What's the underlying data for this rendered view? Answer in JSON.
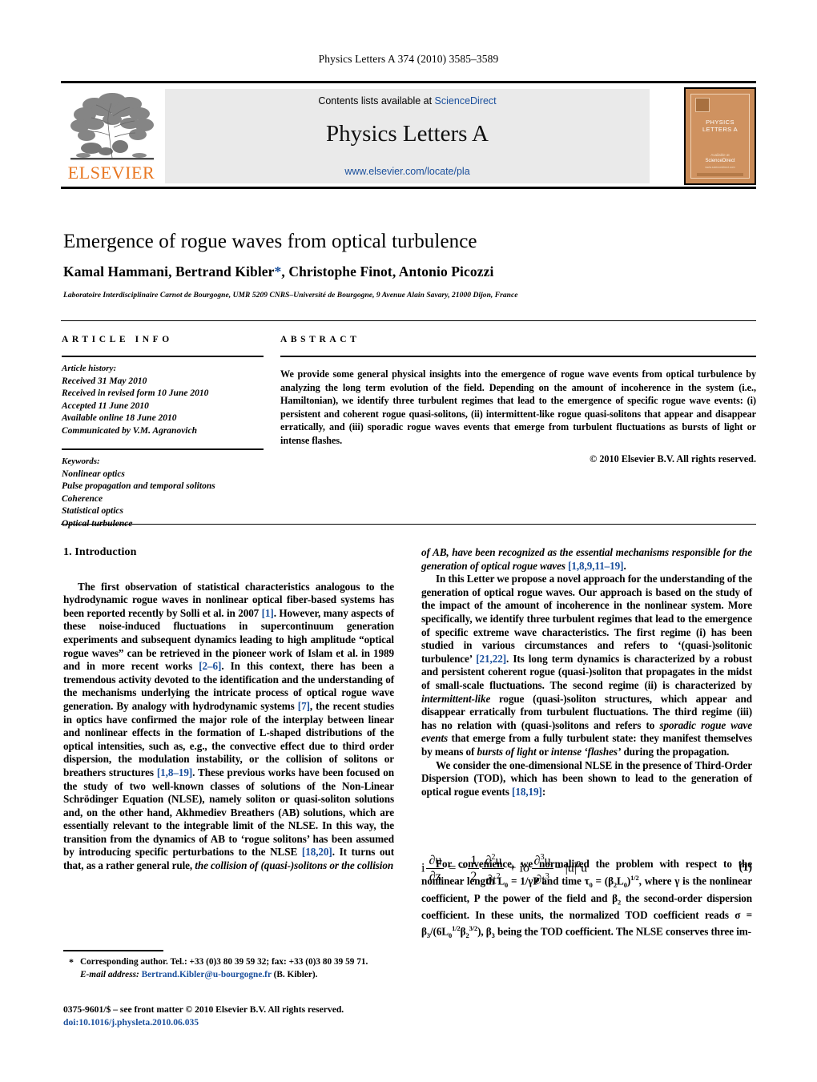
{
  "running_head": "Physics Letters A 374 (2010) 3585–3589",
  "masthead": {
    "contents_line_prefix": "Contents lists available at ",
    "sciencedirect_link": "ScienceDirect",
    "journal_title": "Physics Letters A",
    "journal_url": "www.elsevier.com/locate/pla",
    "publisher_name": "ELSEVIER",
    "cover": {
      "name": "PHYSICS LETTERS A",
      "foot1": "Available at",
      "foot2": "ScienceDirect",
      "foot3": "www.sciencedirect.com",
      "bottom_note": "www.elsevier.com/locate/pla"
    }
  },
  "article": {
    "title": "Emergence of rogue waves from optical turbulence",
    "authors": "Kamal Hammani, Bertrand Kibler",
    "authors_star": "*",
    "authors_rest": ", Christophe Finot, Antonio Picozzi",
    "affiliation": "Laboratoire Interdisciplinaire Carnot de Bourgogne, UMR 5209 CNRS–Université de Bourgogne, 9 Avenue Alain Savary, 21000 Dijon, France"
  },
  "article_info": {
    "heading": "ARTICLE INFO",
    "history_label": "Article history:",
    "history": [
      "Received 31 May 2010",
      "Received in revised form 10 June 2010",
      "Accepted 11 June 2010",
      "Available online 18 June 2010",
      "Communicated by V.M. Agranovich"
    ],
    "keywords_label": "Keywords:",
    "keywords": [
      "Nonlinear optics",
      "Pulse propagation and temporal solitons",
      "Coherence",
      "Statistical optics",
      "Optical turbulence"
    ]
  },
  "abstract": {
    "heading": "ABSTRACT",
    "text": "We provide some general physical insights into the emergence of rogue wave events from optical turbulence by analyzing the long term evolution of the field. Depending on the amount of incoherence in the system (i.e., Hamiltonian), we identify three turbulent regimes that lead to the emergence of specific rogue wave events: (i) persistent and coherent rogue quasi-solitons, (ii) intermittent-like rogue quasi-solitons that appear and disappear erratically, and (iii) sporadic rogue waves events that emerge from turbulent fluctuations as bursts of light or intense flashes.",
    "copyright": "© 2010 Elsevier B.V. All rights reserved."
  },
  "body": {
    "section_heading": "1. Introduction",
    "left_paragraphs": [
      {
        "parts": [
          {
            "t": "The first observation of statistical characteristics analogous to the hydrodynamic rogue waves in nonlinear optical fiber-based systems has been reported recently by Solli et al. in 2007 ",
            "s": "n"
          },
          {
            "t": "[1]",
            "s": "ref"
          },
          {
            "t": ". However, many aspects of these noise-induced fluctuations in supercontinuum generation experiments and subsequent dynamics leading to high amplitude “optical rogue waves” can be retrieved in the pioneer work of Islam et al. in 1989 and in more recent works ",
            "s": "n"
          },
          {
            "t": "[2–6]",
            "s": "ref"
          },
          {
            "t": ". In this context, there has been a tremendous activity devoted to the identification and the understanding of the mechanisms underlying the intricate process of optical rogue wave generation. By analogy with hydrodynamic systems ",
            "s": "n"
          },
          {
            "t": "[7]",
            "s": "ref"
          },
          {
            "t": ", the recent studies in optics have confirmed the major role of the interplay between linear and nonlinear effects in the formation of L-shaped distributions of the optical intensities, such as, e.g., the convective effect due to third order dispersion, the modulation instability, or the collision of solitons or breathers structures ",
            "s": "n"
          },
          {
            "t": "[1,8–19]",
            "s": "ref"
          },
          {
            "t": ". These previous works have been focused on the study of two well-known classes of solutions of the Non-Linear Schrödinger Equation (NLSE), namely soliton or quasi-soliton solutions and, on the other hand, Akhmediev Breathers (AB) solutions, which are essentially relevant to the integrable limit of the NLSE. In this way, the transition from the dynamics of AB to ‘rogue solitons’ has been assumed by introducing specific perturbations to the NLSE ",
            "s": "n"
          },
          {
            "t": "[18,20]",
            "s": "ref"
          },
          {
            "t": ". It turns out that, as a rather general rule, ",
            "s": "n"
          },
          {
            "t": "the collision of (quasi-)solitons or the collision",
            "s": "i"
          }
        ],
        "indent": true
      }
    ],
    "right_paragraphs": [
      {
        "parts": [
          {
            "t": "of AB, have been recognized as the essential mechanisms responsible for the generation of optical rogue waves",
            "s": "i"
          },
          {
            "t": " ",
            "s": "n"
          },
          {
            "t": "[1,8,9,11–19]",
            "s": "ref"
          },
          {
            "t": ".",
            "s": "n"
          }
        ],
        "indent": false
      },
      {
        "parts": [
          {
            "t": "In this Letter we propose a novel approach for the understanding of the generation of optical rogue waves. Our approach is based on the study of the impact of the amount of incoherence in the nonlinear system. More specifically, we identify three turbulent regimes that lead to the emergence of specific extreme wave characteristics. The first regime (i) has been studied in various circumstances and refers to ‘(quasi-)solitonic turbulence’ ",
            "s": "n"
          },
          {
            "t": "[21,22]",
            "s": "ref"
          },
          {
            "t": ". Its long term dynamics is characterized by a robust and persistent coherent rogue (quasi-)soliton that propagates in the midst of small-scale fluctuations. The second regime (ii) is characterized by ",
            "s": "n"
          },
          {
            "t": "intermittent-like",
            "s": "i"
          },
          {
            "t": " rogue (quasi-)soliton structures, which appear and disappear erratically from turbulent fluctuations. The third regime (iii) has no relation with (quasi-)solitons and refers to ",
            "s": "n"
          },
          {
            "t": "sporadic rogue wave events",
            "s": "i"
          },
          {
            "t": " that emerge from a fully turbulent state: they manifest themselves by means of ",
            "s": "n"
          },
          {
            "t": "bursts of light",
            "s": "i"
          },
          {
            "t": " or ",
            "s": "n"
          },
          {
            "t": "intense ‘flashes’",
            "s": "i"
          },
          {
            "t": " during the propagation.",
            "s": "n"
          }
        ],
        "indent": true
      },
      {
        "parts": [
          {
            "t": "We consider the one-dimensional NLSE in the presence of Third-Order Dispersion (TOD), which has been shown to lead to the generation of optical rogue events ",
            "s": "n"
          },
          {
            "t": "[18,19]",
            "s": "ref"
          },
          {
            "t": ":",
            "s": "n"
          }
        ],
        "indent": true
      }
    ],
    "after_equation": {
      "line1": "For convenience, we normalized the problem with respect to",
      "line2_a": "the nonlinear length L",
      "line2_b": " = 1/γP and time τ",
      "line2_c": " = (β",
      "line2_d": "L",
      "line2_e": ")",
      "line2_f": ", where",
      "line3": "γ is the nonlinear coefficient, P the average power of the",
      "line4_a": "field and β",
      "line4_b": " the second-order dispersion coefficient. In these",
      "line5_a": "units, the normalized TOD coefficient reads σ = β",
      "line5_b": "/(6L",
      "line5_c": "β",
      "line5_d": "),",
      "line6_a": "β",
      "line6_b": " being the TOD coefficient. The NLSE conserves three im-"
    }
  },
  "equation": {
    "number": "(1)",
    "lhs_i": "i",
    "lhs_num": "∂u",
    "lhs_den": "∂z",
    "eq": "= −",
    "f1_num": "1",
    "f1_den": "2",
    "f2_num": "∂",
    "f2_num_sup": "2",
    "f2_num_var": "u",
    "f2_den": "∂t",
    "f2_den_sup": "2",
    "plus_io": "+ iσ",
    "f3_num": "∂",
    "f3_num_sup": "3",
    "f3_num_var": "u",
    "f3_den": "∂t",
    "f3_den_sup": "3",
    "tail": "− |u|",
    "tail_sup": "2",
    "tail_u": "u"
  },
  "footnote": {
    "star": "*",
    "text": "Corresponding author. Tel.: +33 (0)3 80 39 59 32; fax: +33 (0)3 80 39 59 71.",
    "email_label": "E-mail address:",
    "email": "Bertrand.Kibler@u-bourgogne.fr",
    "email_owner": "(B. Kibler)."
  },
  "issn_line": {
    "text": "0375-9601/$ – see front matter © 2010 Elsevier B.V. All rights reserved.",
    "doi": "doi:10.1016/j.physleta.2010.06.035"
  },
  "colors": {
    "link": "#1a4f9c",
    "elsevier_orange": "#E87722",
    "panel_gray": "#eaeaea",
    "cover_orange": "#cf9260"
  }
}
